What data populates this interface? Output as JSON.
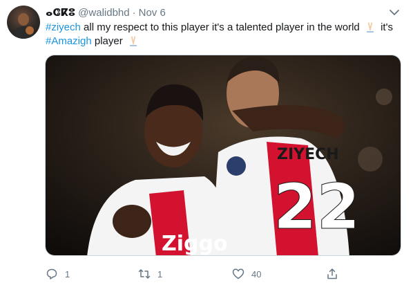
{
  "tweet": {
    "display_name": "ⴰⵛⴽⵓ",
    "handle": "@walidbhd",
    "separator": "·",
    "date": "Nov 6",
    "text": {
      "tag1": "#ziyech",
      "part1": " all my respect to this player it's a talented player in the world ",
      "part2": " it's",
      "tag2": "#Amazigh",
      "part3": " player "
    },
    "media": {
      "jersey_name": "ZIYECH",
      "jersey_number": "22",
      "sponsor": "Ziggo"
    },
    "actions": {
      "reply_count": "1",
      "retweet_count": "1",
      "like_count": "40"
    }
  },
  "colors": {
    "link": "#1b95e0",
    "muted": "#657786",
    "ajax_red": "#d2122e"
  },
  "icons": [
    "caret-down-icon",
    "praying-hands-emoji",
    "reply-icon",
    "retweet-icon",
    "like-icon",
    "share-icon"
  ]
}
